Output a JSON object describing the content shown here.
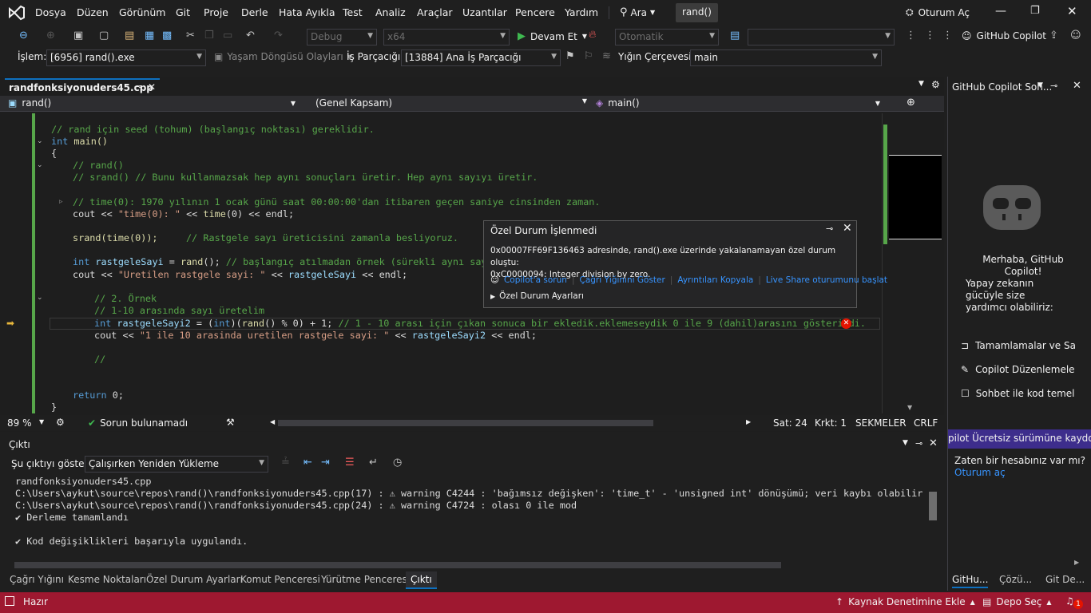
{
  "menu": {
    "items": [
      "Dosya",
      "Düzen",
      "Görünüm",
      "Git",
      "Proje",
      "Derle",
      "Hata Ayıkla",
      "Test",
      "Analiz",
      "Araçlar",
      "Uzantılar",
      "Pencere",
      "Yardım"
    ],
    "search_label": "Ara",
    "solution_name": "rand()",
    "signin_label": "Oturum Aç"
  },
  "toolbar": {
    "config": "Debug",
    "platform": "x64",
    "continue_label": "Devam Et",
    "auto_label": "Otomatik",
    "copilot_label": "GitHub Copilot"
  },
  "debugbar": {
    "process_label": "İşlem:",
    "process_value": "[6956] rand().exe",
    "lifecycle_label": "Yaşam Döngüsü Olayları",
    "thread_label": "İş Parçacığı:",
    "thread_value": "[13884] Ana İş Parçacığı",
    "stackframe_label": "Yığın Çerçevesi:",
    "stackframe_value": "main"
  },
  "editor": {
    "tab_title": "randfonksiyonuders45.cpp",
    "nav_left": "rand()",
    "nav_mid": "(Genel Kapsam)",
    "nav_right": "main()",
    "zoom": "89 %",
    "issues": "Sorun bulunamadı",
    "line": "Sat: 24",
    "col": "Krkt: 1",
    "tabs": "SEKMELER",
    "eol": "CRLF"
  },
  "code": {
    "l1": "// rand için seed (tohum) (başlangıç noktası) gereklidir.",
    "l2_kw": "int",
    "l2_fn": " main()",
    "l3": "{",
    "l4": "// rand()",
    "l5": "// srand() // Bunu kullanmazsak hep aynı sonuçları üretir. Hep aynı sayıyı üretir.",
    "l6": "// time(0): 1970 yılının 1 ocak günü saat 00:00:00'dan itibaren geçen saniye cinsinden zaman.",
    "l7a": "cout << ",
    "l7b": "\"time(0): \"",
    "l7c": " << ",
    "l7d": "time",
    "l7e": "(0) << endl;",
    "l8a": "srand(time(0));",
    "l8b": "     // Rastgele sayı üreticisini zamanla besliyoruz.",
    "l9a": "int ",
    "l9b": "rastgeleSayi",
    "l9c": " = ",
    "l9d": "rand",
    "l9e": "(); ",
    "l9f": "// başlangıç atılmadan örnek (sürekli aynı sayı)",
    "l10a": "cout << ",
    "l10b": "\"Uretilen rastgele sayi: \"",
    "l10c": " << ",
    "l10d": "rastgeleSayi",
    "l10e": " << endl;",
    "l11": "// 2. Örnek",
    "l12": "// 1-10 arasında sayı üretelim",
    "l13a": "int ",
    "l13b": "rastgeleSayi2",
    "l13c": " = (",
    "l13d": "int",
    "l13e": ")(",
    "l13f": "rand",
    "l13g": "() % 0) + 1; ",
    "l13h": "// 1 - 10 arası için çıkan sonuca bir ekledik.eklemeseydik 0 ile 9 (dahil)arasını gösterirdi.",
    "l14a": "cout << ",
    "l14b": "\"1 ile 10 arasinda uretilen rastgele sayi: \"",
    "l14c": " << ",
    "l14d": "rastgeleSayi2",
    "l14e": " << endl;",
    "l15": "//",
    "l16a": "return ",
    "l16b": "0;",
    "l17": "}"
  },
  "popup": {
    "title": "Özel Durum İşlenmedi",
    "message1": "0x00007FF69F136463 adresinde, rand().exe üzerinde yakalanamayan özel durum oluştu:",
    "message2": "0xC0000094: Integer division by zero.",
    "link1": "Copilot'a sorun",
    "link2": "Çağrı Yığınını Göster",
    "link3": "Ayrıntıları Kopyala",
    "link4": "Live Share oturumunu başlat",
    "settings": "Özel Durum Ayarları"
  },
  "output": {
    "title": "Çıktı",
    "show_label": "Şu çıktıyı göster:",
    "source": "Çalışırken Yeniden Yükleme",
    "lines": [
      "randfonksiyonuders45.cpp",
      "C:\\Users\\aykut\\source\\repos\\rand()\\randfonksiyonuders45.cpp(17) : ⚠ warning C4244 : 'bağımsız değişken': 'time_t' - 'unsigned int' dönüşümü; veri kaybı olabilir",
      "C:\\Users\\aykut\\source\\repos\\rand()\\randfonksiyonuders45.cpp(24) : ⚠ warning C4724 : olası 0 ile mod",
      "✔ Derleme tamamlandı",
      "",
      "✔ Kod değişiklikleri başarıyla uygulandı."
    ]
  },
  "bottom_tabs": [
    "Çağrı Yığını",
    "Kesme Noktaları",
    "Özel Durum Ayarları",
    "Komut Penceresi",
    "Yürütme Penceresi",
    "Çıktı"
  ],
  "copilot": {
    "title": "GitHub Copilot Soh...",
    "greeting": "Merhaba, GitHub Copilot!",
    "subtitle": "Yapay zekanın gücüyle size yardımcı olabiliriz:",
    "feature1": "Tamamlamalar ve Sa",
    "feature2": "Copilot Düzenlemele",
    "feature3": "Sohbet ile kod temel",
    "banner": "pilot Ücretsiz sürümüne kaydo",
    "account_q": "Zaten bir hesabınız var mı?",
    "signin": "Oturum aç",
    "tab1": "GitHu...",
    "tab2": "Çözü...",
    "tab3": "Git De..."
  },
  "status": {
    "ready": "Hazır",
    "source_control": "Kaynak Denetimine Ekle",
    "repo": "Depo Seç",
    "notif_count": "1"
  },
  "colors": {
    "accent": "#0e70c0",
    "statusbar": "#9e1830",
    "comment": "#57a64a",
    "keyword": "#569cd6"
  }
}
